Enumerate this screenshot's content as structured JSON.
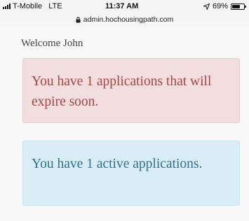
{
  "status_bar": {
    "carrier": "T-Mobile",
    "network": "LTE",
    "time": "11:37 AM",
    "battery": "69%",
    "battery_level": 0.69
  },
  "browser": {
    "url": "admin.hochousingpath.com"
  },
  "page": {
    "welcome": "Welcome John",
    "alert_expiring": "You have 1 applications that will expire soon.",
    "alert_active": "You have 1 active applications."
  },
  "colors": {
    "danger_bg": "#f2dede",
    "danger_text": "#a94442",
    "info_bg": "#d9edf7",
    "info_text": "#31708f"
  }
}
